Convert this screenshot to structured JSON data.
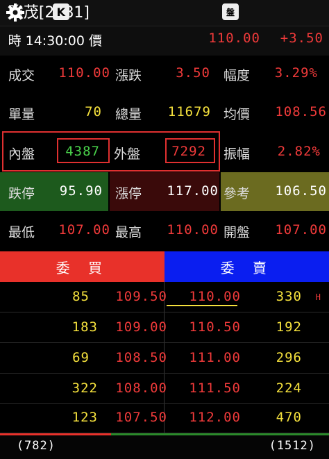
{
  "header": {
    "title": "強茂[2481]",
    "k_label": "K",
    "board_label": "盤",
    "gear_icon": "gear-icon"
  },
  "quote": {
    "time_label": "時 14:30:00 價",
    "price": "110.00",
    "change": "+3.50"
  },
  "rows": [
    {
      "l1": "成交",
      "v1": "110.00",
      "l2": "漲跌",
      "v2": "3.50",
      "l3": "幅度",
      "v3": "3.29%"
    },
    {
      "l1": "單量",
      "v1": "70",
      "l2": "總量",
      "v2": "11679",
      "l3": "均價",
      "v3": "108.56"
    },
    {
      "l1": "內盤",
      "v1": "4387",
      "l2": "外盤",
      "v2": "7292",
      "l3": "振幅",
      "v3": "2.82%"
    },
    {
      "l1": "跌停",
      "v1": "95.90",
      "l2": "漲停",
      "v2": "117.00",
      "l3": "參考",
      "v3": "106.50"
    },
    {
      "l1": "最低",
      "v1": "107.00",
      "l2": "最高",
      "v2": "110.00",
      "l3": "開盤",
      "v3": "107.00"
    }
  ],
  "book": {
    "buy_label": "委 買",
    "sell_label": "委 賣",
    "bids": [
      {
        "qty": "85",
        "price": "109.50"
      },
      {
        "qty": "183",
        "price": "109.00"
      },
      {
        "qty": "69",
        "price": "108.50"
      },
      {
        "qty": "322",
        "price": "108.00"
      },
      {
        "qty": "123",
        "price": "107.50"
      }
    ],
    "asks": [
      {
        "price": "110.00",
        "qty": "330",
        "flag": "H"
      },
      {
        "price": "110.50",
        "qty": "192",
        "flag": ""
      },
      {
        "price": "111.00",
        "qty": "296",
        "flag": ""
      },
      {
        "price": "111.50",
        "qty": "224",
        "flag": ""
      },
      {
        "price": "112.00",
        "qty": "470",
        "flag": ""
      }
    ],
    "bid_total": "(782)",
    "ask_total": "(1512)"
  },
  "colors": {
    "buy_header": "#e8312a",
    "sell_header": "#0a1ef0",
    "limit_down_bg": "#1d5a1d",
    "limit_up_bg": "#3a0a0a",
    "ref_bg": "#6b6b20"
  }
}
